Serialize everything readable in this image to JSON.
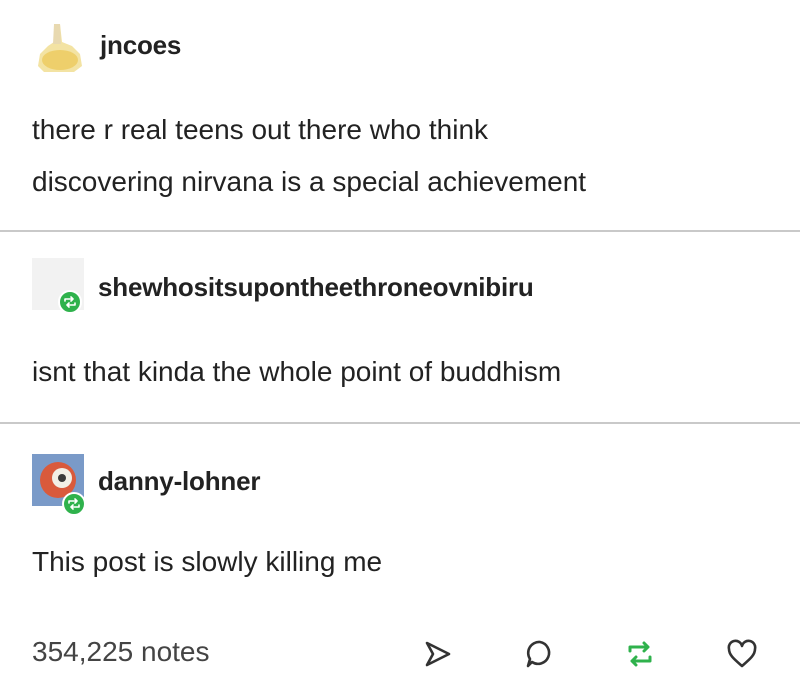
{
  "posts": [
    {
      "username": "jncoes",
      "text_lines": [
        "there r real teens out there who think",
        "discovering nirvana is a special achievement"
      ]
    },
    {
      "username": "shewhositsupontheethroneovnibiru",
      "text_lines": [
        "isnt that kinda the whole point of buddhism"
      ]
    },
    {
      "username": "danny-lohner",
      "text_lines": [
        "This post is slowly killing me"
      ]
    }
  ],
  "footer": {
    "notes": "354,225 notes",
    "icons": [
      "share-icon",
      "reply-icon",
      "reblog-icon",
      "like-icon"
    ]
  },
  "colors": {
    "reblog_green": "#2fb24c",
    "divider": "#c9c9c9",
    "text": "#222222",
    "muted": "#444444"
  }
}
